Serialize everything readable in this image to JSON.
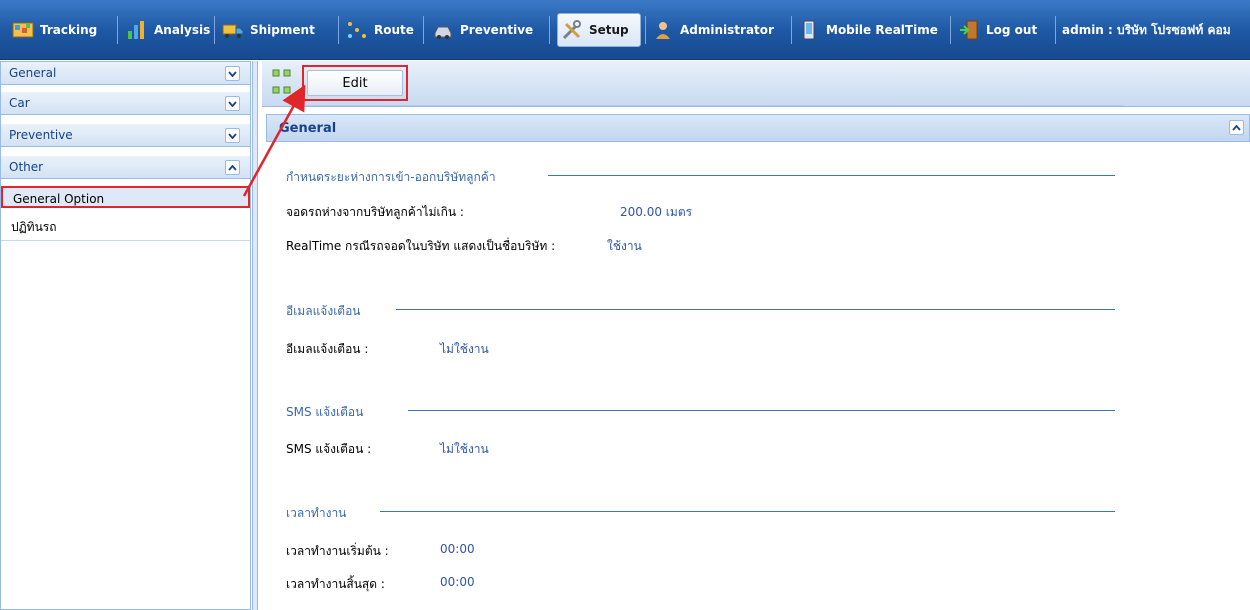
{
  "nav": {
    "tracking": "Tracking",
    "analysis": "Analysis",
    "shipment": "Shipment",
    "route": "Route",
    "preventive": "Preventive",
    "setup": "Setup",
    "administrator": "Administrator",
    "mobile_realtime": "Mobile RealTime",
    "logout": "Log out",
    "user": "admin : บริษัท โปรซอฟท์ คอม"
  },
  "sidebar": {
    "sections": [
      "General",
      "Car",
      "Preventive",
      "Other"
    ],
    "other_items": [
      "General Option",
      "ปฏิทินรถ"
    ]
  },
  "toolbar": {
    "edit_label": "Edit"
  },
  "panel": {
    "title": "General",
    "sections": [
      {
        "legend": "กำหนดระยะห่างการเข้า-ออกบริษัทลูกค้า",
        "fields": [
          {
            "label": "จอดรถห่างจากบริษัทลูกค้าไม่เกิน :",
            "value": "200.00 เมตร"
          },
          {
            "label": "RealTime กรณีรถจอดในบริษัท แสดงเป็นชื่อบริษัท :",
            "value": "ใช้งาน"
          }
        ]
      },
      {
        "legend": "อีเมลแจ้งเตือน",
        "fields": [
          {
            "label": "อีเมลแจ้งเตือน :",
            "value": "ไม่ใช้งาน"
          }
        ]
      },
      {
        "legend": "SMS แจ้งเตือน",
        "fields": [
          {
            "label": "SMS แจ้งเตือน :",
            "value": "ไม่ใช้งาน"
          }
        ]
      },
      {
        "legend": "เวลาทำงาน",
        "fields": [
          {
            "label": "เวลาทำงานเริ่มต้น :",
            "value": "00:00"
          },
          {
            "label": "เวลาทำงานสิ้นสุด :",
            "value": "00:00"
          }
        ]
      }
    ]
  },
  "colors": {
    "nav_bar": "#1d57a3",
    "panel_border": "#99bbe8",
    "value_text": "#2e56a8",
    "annotation": "#e0262b"
  }
}
